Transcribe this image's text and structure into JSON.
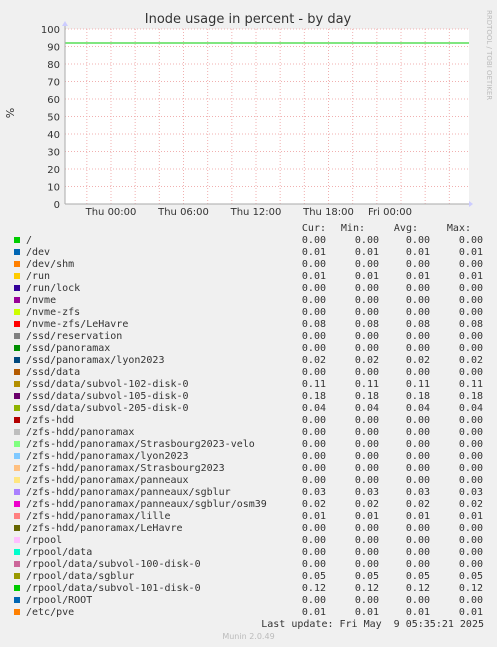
{
  "chart_data": {
    "type": "line",
    "title": "Inode usage in percent - by day",
    "ylabel": "%",
    "ylim": [
      0,
      100
    ],
    "yticks": [
      0,
      10,
      20,
      30,
      40,
      50,
      60,
      70,
      80,
      90,
      100
    ],
    "xticks": [
      "Thu 00:00",
      "Thu 06:00",
      "Thu 12:00",
      "Thu 18:00",
      "Fri 00:00"
    ],
    "grid": true,
    "side_label": "RRDTOOL / TOBI OETIKER",
    "line_series": [
      {
        "label": "/",
        "value": 92,
        "color": "#00cc00"
      }
    ]
  },
  "legend": {
    "headers": [
      "Cur:",
      "Min:",
      "Avg:",
      "Max:"
    ],
    "rows": [
      {
        "label": "/",
        "color": "#00cc00",
        "cur": "0.00",
        "min": "0.00",
        "avg": "0.00",
        "max": "0.00"
      },
      {
        "label": "/dev",
        "color": "#0066b3",
        "cur": "0.01",
        "min": "0.01",
        "avg": "0.01",
        "max": "0.01"
      },
      {
        "label": "/dev/shm",
        "color": "#ff8000",
        "cur": "0.00",
        "min": "0.00",
        "avg": "0.00",
        "max": "0.00"
      },
      {
        "label": "/run",
        "color": "#ffcc00",
        "cur": "0.01",
        "min": "0.01",
        "avg": "0.01",
        "max": "0.01"
      },
      {
        "label": "/run/lock",
        "color": "#330099",
        "cur": "0.00",
        "min": "0.00",
        "avg": "0.00",
        "max": "0.00"
      },
      {
        "label": "/nvme",
        "color": "#990099",
        "cur": "0.00",
        "min": "0.00",
        "avg": "0.00",
        "max": "0.00"
      },
      {
        "label": "/nvme-zfs",
        "color": "#ccff00",
        "cur": "0.00",
        "min": "0.00",
        "avg": "0.00",
        "max": "0.00"
      },
      {
        "label": "/nvme-zfs/LeHavre",
        "color": "#ff0000",
        "cur": "0.08",
        "min": "0.08",
        "avg": "0.08",
        "max": "0.08"
      },
      {
        "label": "/ssd/reservation",
        "color": "#808080",
        "cur": "0.00",
        "min": "0.00",
        "avg": "0.00",
        "max": "0.00"
      },
      {
        "label": "/ssd/panoramax",
        "color": "#008f00",
        "cur": "0.00",
        "min": "0.00",
        "avg": "0.00",
        "max": "0.00"
      },
      {
        "label": "/ssd/panoramax/lyon2023",
        "color": "#00487d",
        "cur": "0.02",
        "min": "0.02",
        "avg": "0.02",
        "max": "0.02"
      },
      {
        "label": "/ssd/data",
        "color": "#b35a00",
        "cur": "0.00",
        "min": "0.00",
        "avg": "0.00",
        "max": "0.00"
      },
      {
        "label": "/ssd/data/subvol-102-disk-0",
        "color": "#b38f00",
        "cur": "0.11",
        "min": "0.11",
        "avg": "0.11",
        "max": "0.11"
      },
      {
        "label": "/ssd/data/subvol-105-disk-0",
        "color": "#6b006b",
        "cur": "0.18",
        "min": "0.18",
        "avg": "0.18",
        "max": "0.18"
      },
      {
        "label": "/ssd/data/subvol-205-disk-0",
        "color": "#8fb300",
        "cur": "0.04",
        "min": "0.04",
        "avg": "0.04",
        "max": "0.04"
      },
      {
        "label": "/zfs-hdd",
        "color": "#b30000",
        "cur": "0.00",
        "min": "0.00",
        "avg": "0.00",
        "max": "0.00"
      },
      {
        "label": "/zfs-hdd/panoramax",
        "color": "#bebebe",
        "cur": "0.00",
        "min": "0.00",
        "avg": "0.00",
        "max": "0.00"
      },
      {
        "label": "/zfs-hdd/panoramax/Strasbourg2023-velo",
        "color": "#80ff80",
        "cur": "0.00",
        "min": "0.00",
        "avg": "0.00",
        "max": "0.00"
      },
      {
        "label": "/zfs-hdd/panoramax/lyon2023",
        "color": "#80c9ff",
        "cur": "0.00",
        "min": "0.00",
        "avg": "0.00",
        "max": "0.00"
      },
      {
        "label": "/zfs-hdd/panoramax/Strasbourg2023",
        "color": "#ffc080",
        "cur": "0.00",
        "min": "0.00",
        "avg": "0.00",
        "max": "0.00"
      },
      {
        "label": "/zfs-hdd/panoramax/panneaux",
        "color": "#ffe680",
        "cur": "0.00",
        "min": "0.00",
        "avg": "0.00",
        "max": "0.00"
      },
      {
        "label": "/zfs-hdd/panoramax/panneaux/sgblur",
        "color": "#aa80ff",
        "cur": "0.03",
        "min": "0.03",
        "avg": "0.03",
        "max": "0.03"
      },
      {
        "label": "/zfs-hdd/panoramax/panneaux/sgblur/osm39",
        "color": "#ee00cc",
        "cur": "0.02",
        "min": "0.02",
        "avg": "0.02",
        "max": "0.02"
      },
      {
        "label": "/zfs-hdd/panoramax/lille",
        "color": "#ff8080",
        "cur": "0.01",
        "min": "0.01",
        "avg": "0.01",
        "max": "0.01"
      },
      {
        "label": "/zfs-hdd/panoramax/LeHavre",
        "color": "#666600",
        "cur": "0.00",
        "min": "0.00",
        "avg": "0.00",
        "max": "0.00"
      },
      {
        "label": "/rpool",
        "color": "#ffbfff",
        "cur": "0.00",
        "min": "0.00",
        "avg": "0.00",
        "max": "0.00"
      },
      {
        "label": "/rpool/data",
        "color": "#00ffcc",
        "cur": "0.00",
        "min": "0.00",
        "avg": "0.00",
        "max": "0.00"
      },
      {
        "label": "/rpool/data/subvol-100-disk-0",
        "color": "#cc6699",
        "cur": "0.00",
        "min": "0.00",
        "avg": "0.00",
        "max": "0.00"
      },
      {
        "label": "/rpool/data/sgblur",
        "color": "#999900",
        "cur": "0.05",
        "min": "0.05",
        "avg": "0.05",
        "max": "0.05"
      },
      {
        "label": "/rpool/data/subvol-101-disk-0",
        "color": "#00cc00",
        "cur": "0.12",
        "min": "0.12",
        "avg": "0.12",
        "max": "0.12"
      },
      {
        "label": "/rpool/ROOT",
        "color": "#0066b3",
        "cur": "0.00",
        "min": "0.00",
        "avg": "0.00",
        "max": "0.00"
      },
      {
        "label": "/etc/pve",
        "color": "#ff8000",
        "cur": "0.01",
        "min": "0.01",
        "avg": "0.01",
        "max": "0.01"
      }
    ]
  },
  "footer": {
    "last_update": "Last update: Fri May  9 05:35:21 2025",
    "munin": "Munin 2.0.49"
  }
}
